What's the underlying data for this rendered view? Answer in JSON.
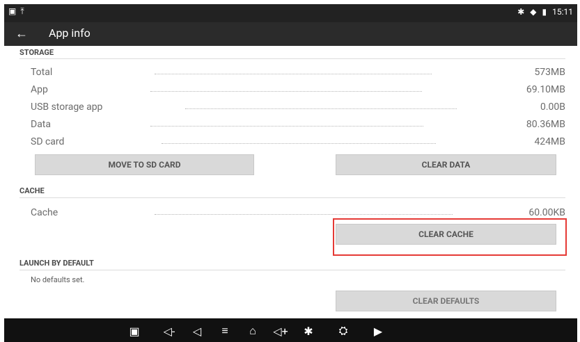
{
  "status_bar": {
    "icons_left": [
      "image-icon",
      "upload-icon"
    ],
    "icons_right": [
      "bluetooth-icon",
      "wifi-icon",
      "battery-icon"
    ],
    "time": "15:11"
  },
  "app_bar": {
    "title": "App info",
    "back_icon": "arrow-back-icon"
  },
  "storage": {
    "title": "STORAGE",
    "rows": [
      {
        "label": "Total",
        "value": "573MB"
      },
      {
        "label": "App",
        "value": "69.10MB"
      },
      {
        "label": "USB storage app",
        "value": "0.00B"
      },
      {
        "label": "Data",
        "value": "80.36MB"
      },
      {
        "label": "SD card",
        "value": "424MB"
      }
    ],
    "buttons": {
      "move_to_sd": "MOVE TO SD CARD",
      "clear_data": "CLEAR DATA"
    }
  },
  "cache": {
    "title": "CACHE",
    "row": {
      "label": "Cache",
      "value": "60.00KB"
    },
    "button": "CLEAR CACHE"
  },
  "launch_default": {
    "title": "LAUNCH BY DEFAULT",
    "text": "No defaults set.",
    "button": "CLEAR DEFAULTS"
  },
  "nav_bar": {
    "icons": [
      "gallery-icon",
      "volume-down-icon",
      "back-icon",
      "menu-icon",
      "home-icon",
      "volume-up-icon",
      "bluetooth-icon",
      "car-diagnostic-icon",
      "screen-record-icon"
    ]
  },
  "colors": {
    "highlight": "#e53935",
    "status_bar": "#222222",
    "app_bar": "#2b2b2b",
    "nav_bar": "#111111"
  }
}
